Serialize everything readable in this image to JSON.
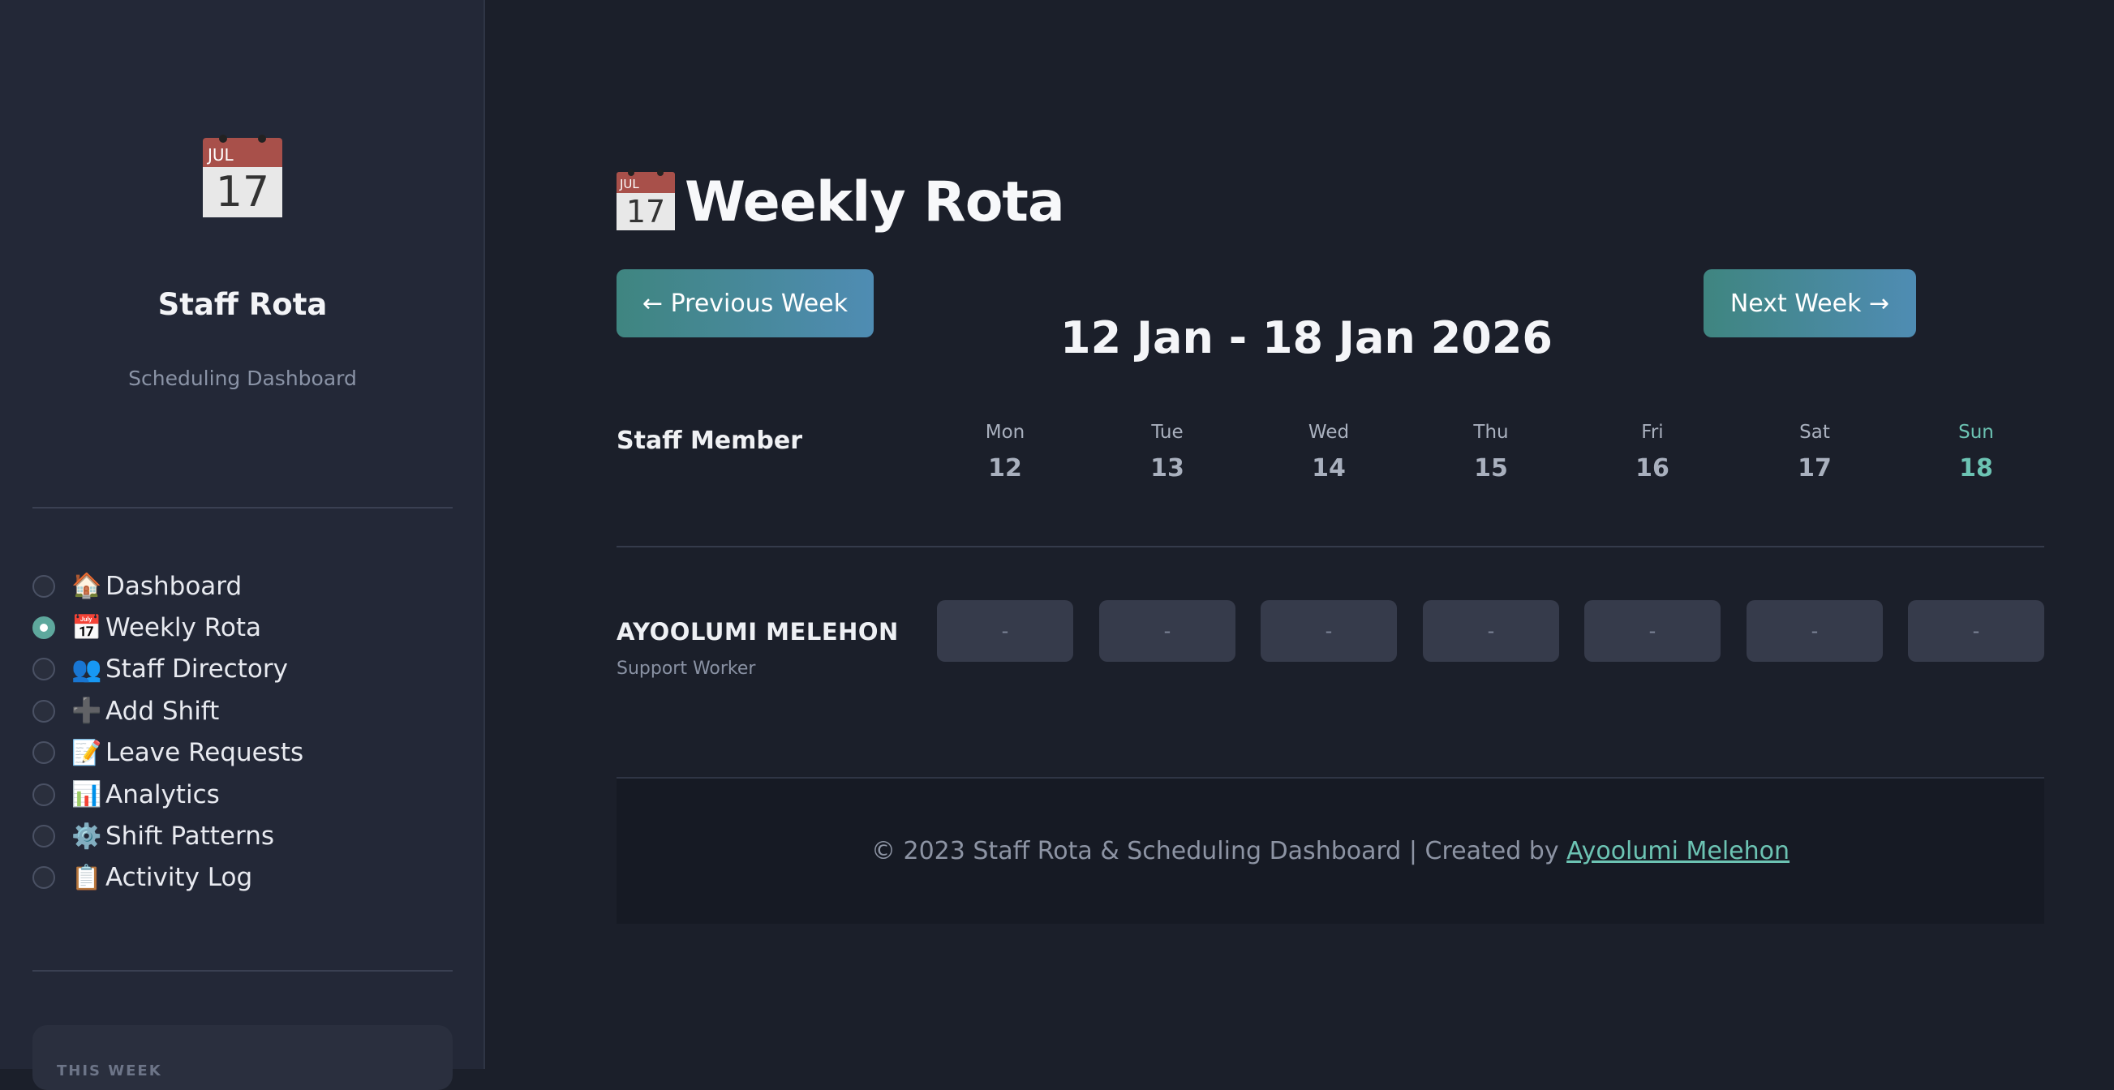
{
  "sidebar": {
    "logo_icon": "calendar-icon",
    "logo_month": "JUL",
    "logo_day": "17",
    "title": "Staff Rota",
    "subtitle": "Scheduling Dashboard",
    "nav": [
      {
        "icon": "🏠",
        "label": "Dashboard",
        "selected": false
      },
      {
        "icon": "📅",
        "label": "Weekly Rota",
        "selected": true
      },
      {
        "icon": "👥",
        "label": "Staff Directory",
        "selected": false
      },
      {
        "icon": "➕",
        "label": "Add Shift",
        "selected": false
      },
      {
        "icon": "📝",
        "label": "Leave Requests",
        "selected": false
      },
      {
        "icon": "📊",
        "label": "Analytics",
        "selected": false
      },
      {
        "icon": "⚙️",
        "label": "Shift Patterns",
        "selected": false
      },
      {
        "icon": "📋",
        "label": "Activity Log",
        "selected": false
      }
    ],
    "card_label": "THIS WEEK"
  },
  "main": {
    "title": "Weekly Rota",
    "prev_button": "← Previous Week",
    "next_button": "Next Week →",
    "week_range": "12 Jan - 18 Jan 2026",
    "staff_col_header": "Staff Member",
    "days": [
      {
        "name": "Mon",
        "num": "12",
        "today": false
      },
      {
        "name": "Tue",
        "num": "13",
        "today": false
      },
      {
        "name": "Wed",
        "num": "14",
        "today": false
      },
      {
        "name": "Thu",
        "num": "15",
        "today": false
      },
      {
        "name": "Fri",
        "num": "16",
        "today": false
      },
      {
        "name": "Sat",
        "num": "17",
        "today": false
      },
      {
        "name": "Sun",
        "num": "18",
        "today": true
      }
    ],
    "staff": [
      {
        "name": "AYOOLUMI MELEHON",
        "role": "Support Worker",
        "shifts": [
          "-",
          "-",
          "-",
          "-",
          "-",
          "-",
          "-"
        ]
      }
    ]
  },
  "footer": {
    "text": "© 2023 Staff Rota & Scheduling Dashboard | Created by ",
    "link": "Ayoolumi Melehon"
  },
  "colors": {
    "accent": "#6cc3b3",
    "button_gradient_start": "#3f8580",
    "button_gradient_end": "#4f8cb3",
    "background": "#1b1f2a",
    "sidebar": "#232837"
  }
}
